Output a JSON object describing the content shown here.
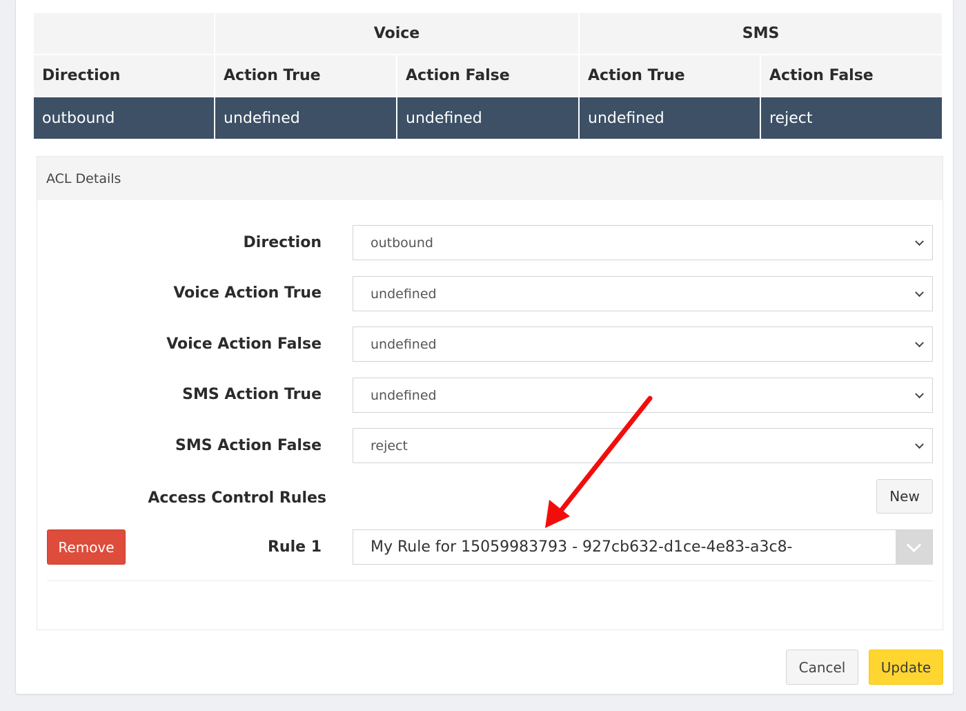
{
  "table": {
    "group_headers": [
      "",
      "Voice",
      "SMS"
    ],
    "columns": [
      "Direction",
      "Action True",
      "Action False",
      "Action True",
      "Action False"
    ],
    "rows": [
      [
        "outbound",
        "undefined",
        "undefined",
        "undefined",
        "reject"
      ]
    ]
  },
  "panel": {
    "title": "ACL Details",
    "fields": [
      {
        "label": "Direction",
        "value": "outbound"
      },
      {
        "label": "Voice Action True",
        "value": "undefined"
      },
      {
        "label": "Voice Action False",
        "value": "undefined"
      },
      {
        "label": "SMS Action True",
        "value": "undefined"
      },
      {
        "label": "SMS Action False",
        "value": "reject"
      }
    ],
    "rules_label": "Access Control Rules",
    "new_button": "New",
    "rule": {
      "label": "Rule 1",
      "value": "My Rule for 15059983793 - 927cb632-d1ce-4e83-a3c8-",
      "remove_button": "Remove"
    }
  },
  "footer": {
    "cancel_button": "Cancel",
    "update_button": "Update"
  },
  "annotation": {
    "arrow_color": "#f20d0d"
  }
}
